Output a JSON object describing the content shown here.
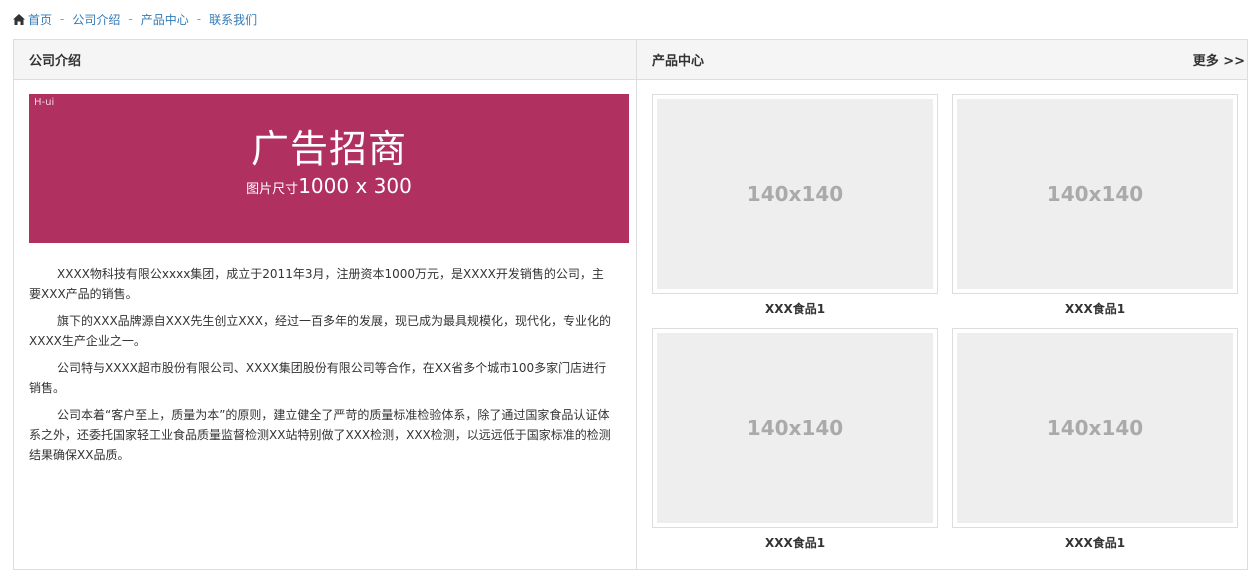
{
  "breadcrumb": {
    "items": [
      "首页",
      "公司介绍",
      "产品中心",
      "联系我们"
    ],
    "separator": "-"
  },
  "about": {
    "title": "公司介绍",
    "banner": {
      "tag": "H-ui",
      "headline": "广告招商",
      "size_label": "图片尺寸",
      "size_value": "1000 x 300",
      "color": "#b03060"
    },
    "paragraphs": [
      "XXXX物科技有限公xxxx集团，成立于2011年3月，注册资本1000万元，是XXXX开发销售的公司，主要XXX产品的销售。",
      "旗下的XXX品牌源自XXX先生创立XXX，经过一百多年的发展，现已成为最具规模化，现代化，专业化的XXXX生产企业之一。",
      "公司特与XXXX超市股份有限公司、XXXX集团股份有限公司等合作，在XX省多个城市100多家门店进行销售。",
      "公司本着“客户至上，质量为本”的原则，建立健全了严苛的质量标准检验体系，除了通过国家食品认证体系之外，还委托国家轻工业食品质量监督检测XX站特别做了XXX检测，XXX检测，以远远低于国家标准的检测结果确保XX品质。"
    ]
  },
  "products": {
    "title": "产品中心",
    "more": "更多 >>",
    "items": [
      {
        "placeholder": "140x140",
        "name": "XXX食品1"
      },
      {
        "placeholder": "140x140",
        "name": "XXX食品1"
      },
      {
        "placeholder": "140x140",
        "name": "XXX食品1"
      },
      {
        "placeholder": "140x140",
        "name": "XXX食品1"
      }
    ]
  },
  "colors": {
    "link": "#337ab7",
    "border": "#ddd",
    "placeholder_bg": "#eee"
  }
}
